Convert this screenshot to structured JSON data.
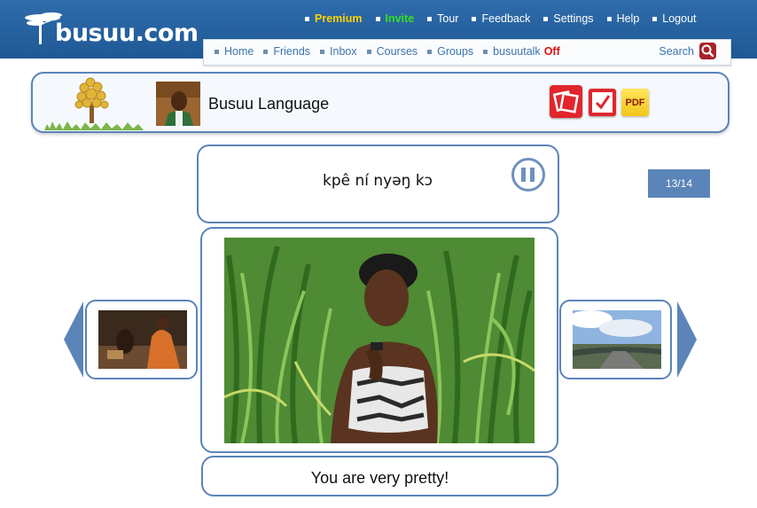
{
  "header": {
    "logo_text": "busuu.com",
    "top_nav": [
      {
        "label": "Premium",
        "style": "premium"
      },
      {
        "label": "Invite",
        "style": "invite"
      },
      {
        "label": "Tour"
      },
      {
        "label": "Feedback"
      },
      {
        "label": "Settings"
      },
      {
        "label": "Help"
      },
      {
        "label": "Logout"
      }
    ],
    "sub_nav": [
      {
        "label": "Home"
      },
      {
        "label": "Friends"
      },
      {
        "label": "Inbox"
      },
      {
        "label": "Courses"
      },
      {
        "label": "Groups"
      },
      {
        "label": "busuutalk",
        "status": "Off"
      }
    ],
    "search_label": "Search"
  },
  "course": {
    "title": "Busuu Language",
    "pdf_label": "PDF"
  },
  "lesson": {
    "phrase": "kpê ní nyəŋ kɔ",
    "counter": "13/14",
    "translation": "You are very pretty!"
  },
  "colors": {
    "header_blue": "#2f6cab",
    "frame_border": "#5b84b8",
    "premium": "#ffd200",
    "invite": "#34e020",
    "off_status": "#e01010"
  }
}
